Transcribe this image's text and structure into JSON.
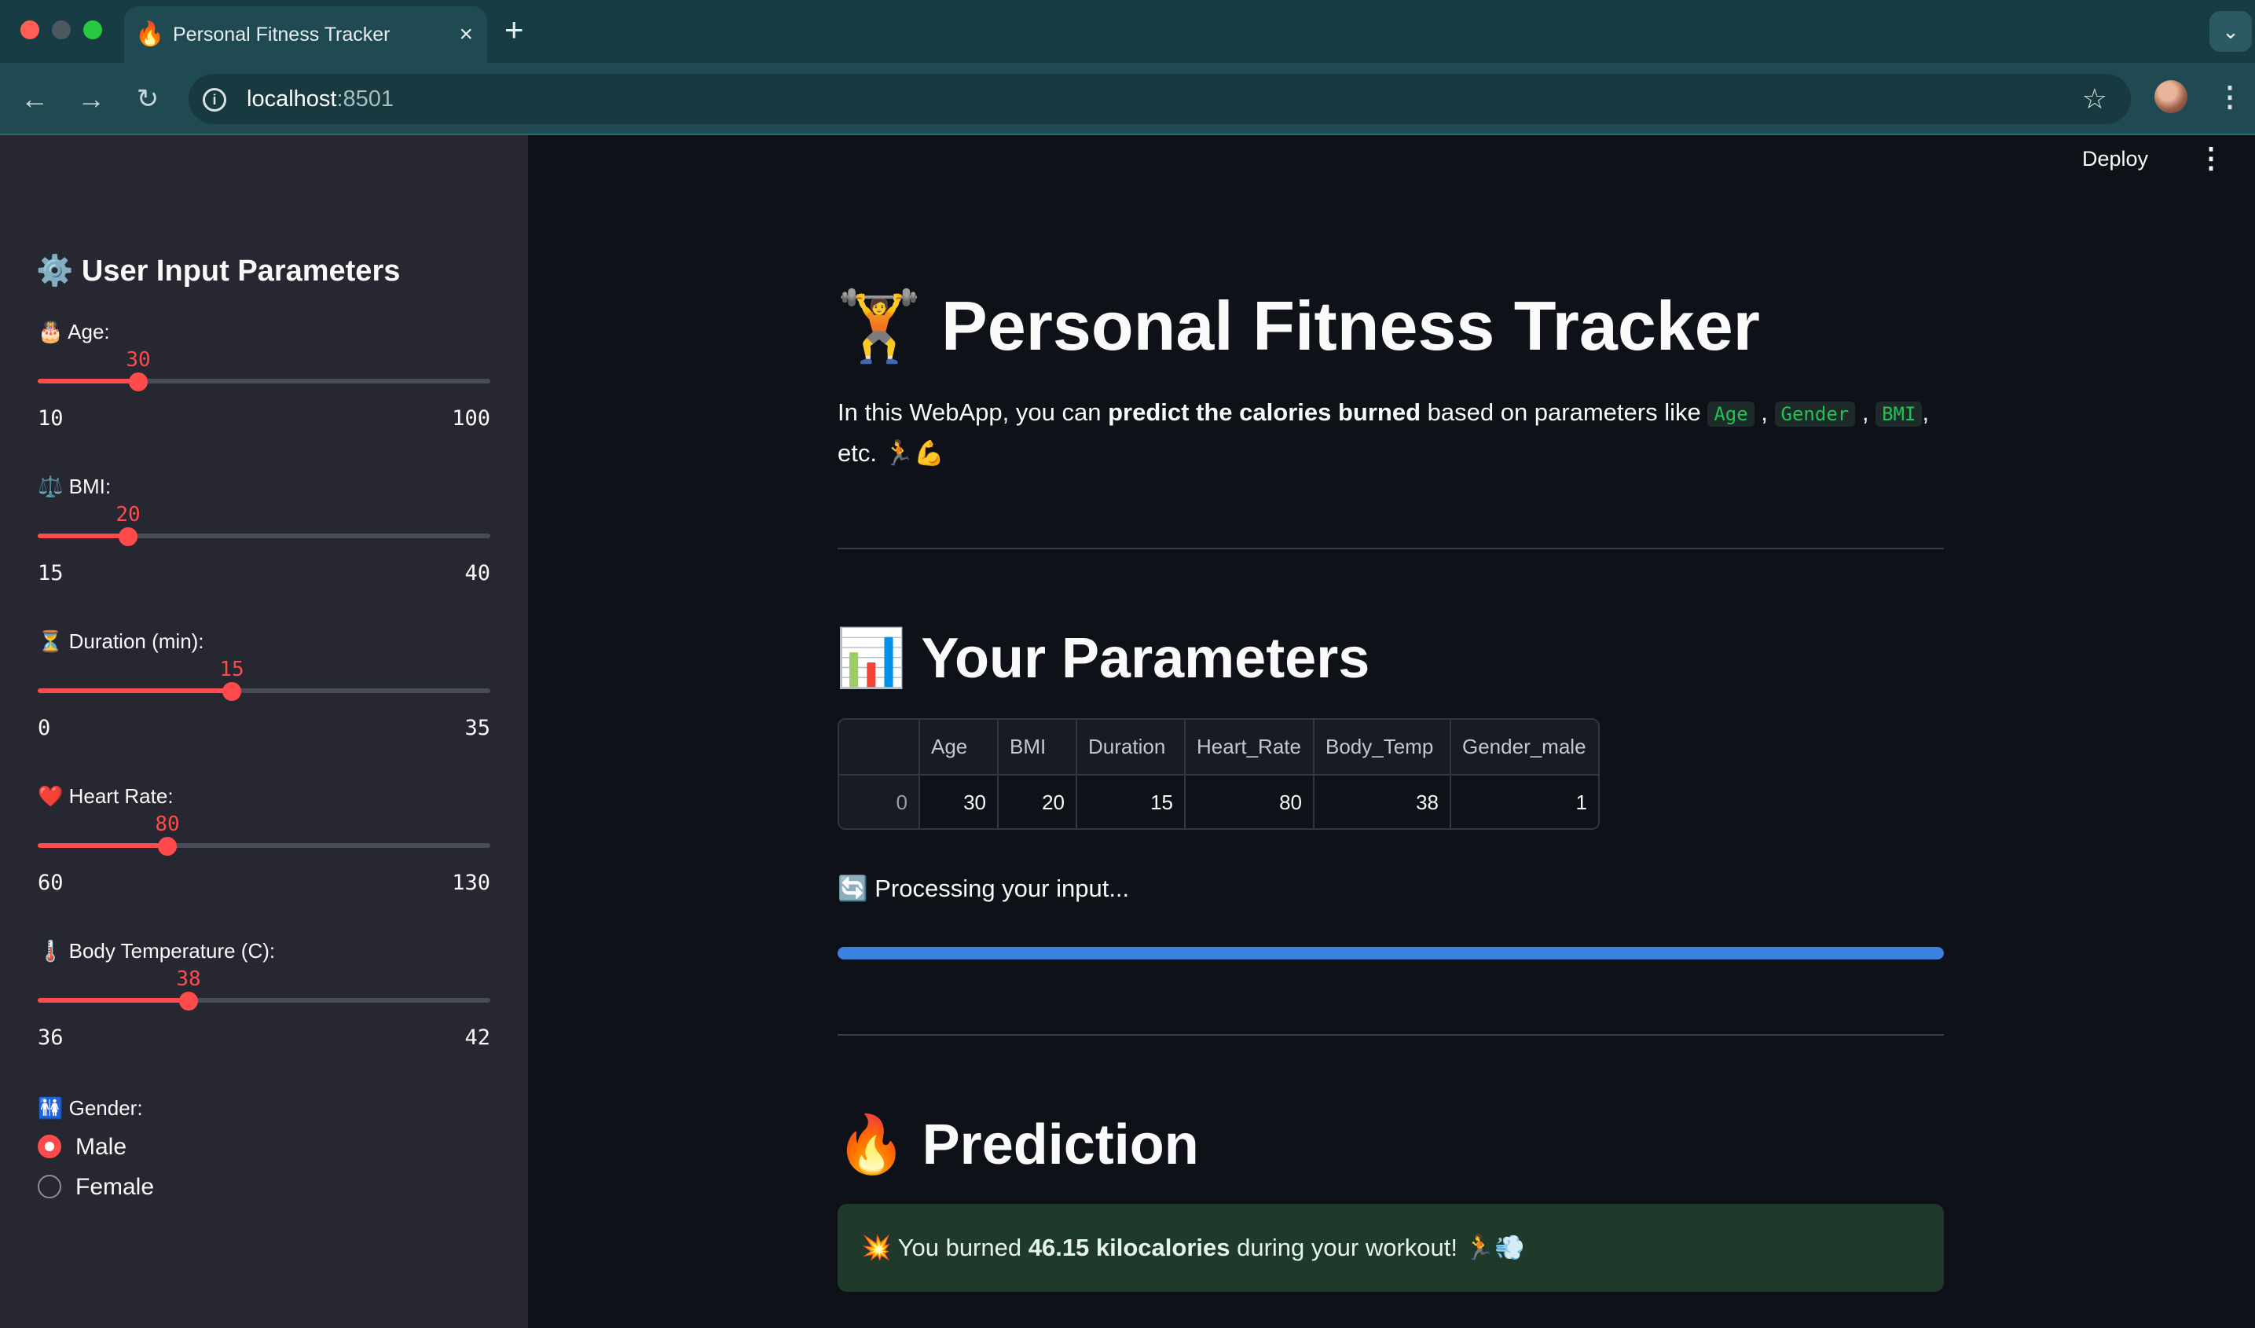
{
  "browser": {
    "tab_title": "Personal Fitness Tracker",
    "tab_favicon": "🔥",
    "url_host": "localhost",
    "url_port": ":8501"
  },
  "header": {
    "deploy_label": "Deploy"
  },
  "sidebar": {
    "title": "⚙️ User Input Parameters",
    "sliders": [
      {
        "label": "🎂 Age:",
        "value": "30",
        "min": "10",
        "max": "100",
        "fraction": 0.2222
      },
      {
        "label": "⚖️ BMI:",
        "value": "20",
        "min": "15",
        "max": "40",
        "fraction": 0.2
      },
      {
        "label": "⏳ Duration (min):",
        "value": "15",
        "min": "0",
        "max": "35",
        "fraction": 0.4286
      },
      {
        "label": "❤️ Heart Rate:",
        "value": "80",
        "min": "60",
        "max": "130",
        "fraction": 0.2857
      },
      {
        "label": "🌡️ Body Temperature (C):",
        "value": "38",
        "min": "36",
        "max": "42",
        "fraction": 0.3333
      }
    ],
    "gender": {
      "label": "🚻 Gender:",
      "options": [
        "Male",
        "Female"
      ],
      "selected": "Male"
    }
  },
  "main": {
    "title": "🏋️ Personal Fitness Tracker",
    "intro": {
      "prefix": "In this WebApp, you can ",
      "bold": "predict the calories burned",
      "middle": " based on parameters like ",
      "codes": [
        "Age",
        "Gender",
        "BMI"
      ],
      "suffix": ", etc. 🏃💪"
    },
    "params_heading": "📊 Your Parameters",
    "table": {
      "columns": [
        "",
        "Age",
        "BMI",
        "Duration",
        "Heart_Rate",
        "Body_Temp",
        "Gender_male"
      ],
      "rows": [
        [
          "0",
          "30",
          "20",
          "15",
          "80",
          "38",
          "1"
        ]
      ]
    },
    "processing_text": "🔄 Processing your input...",
    "progress": 1.0,
    "prediction_heading": "🔥 Prediction",
    "prediction": {
      "prefix": "💥 You burned ",
      "bold": "46.15 kilocalories",
      "suffix": " during your workout! 🏃💨"
    }
  },
  "colors": {
    "accent": "#ff4b4b",
    "progress": "#3b82e0",
    "success_bg": "#1f3a2b",
    "code_text": "#21c354"
  }
}
